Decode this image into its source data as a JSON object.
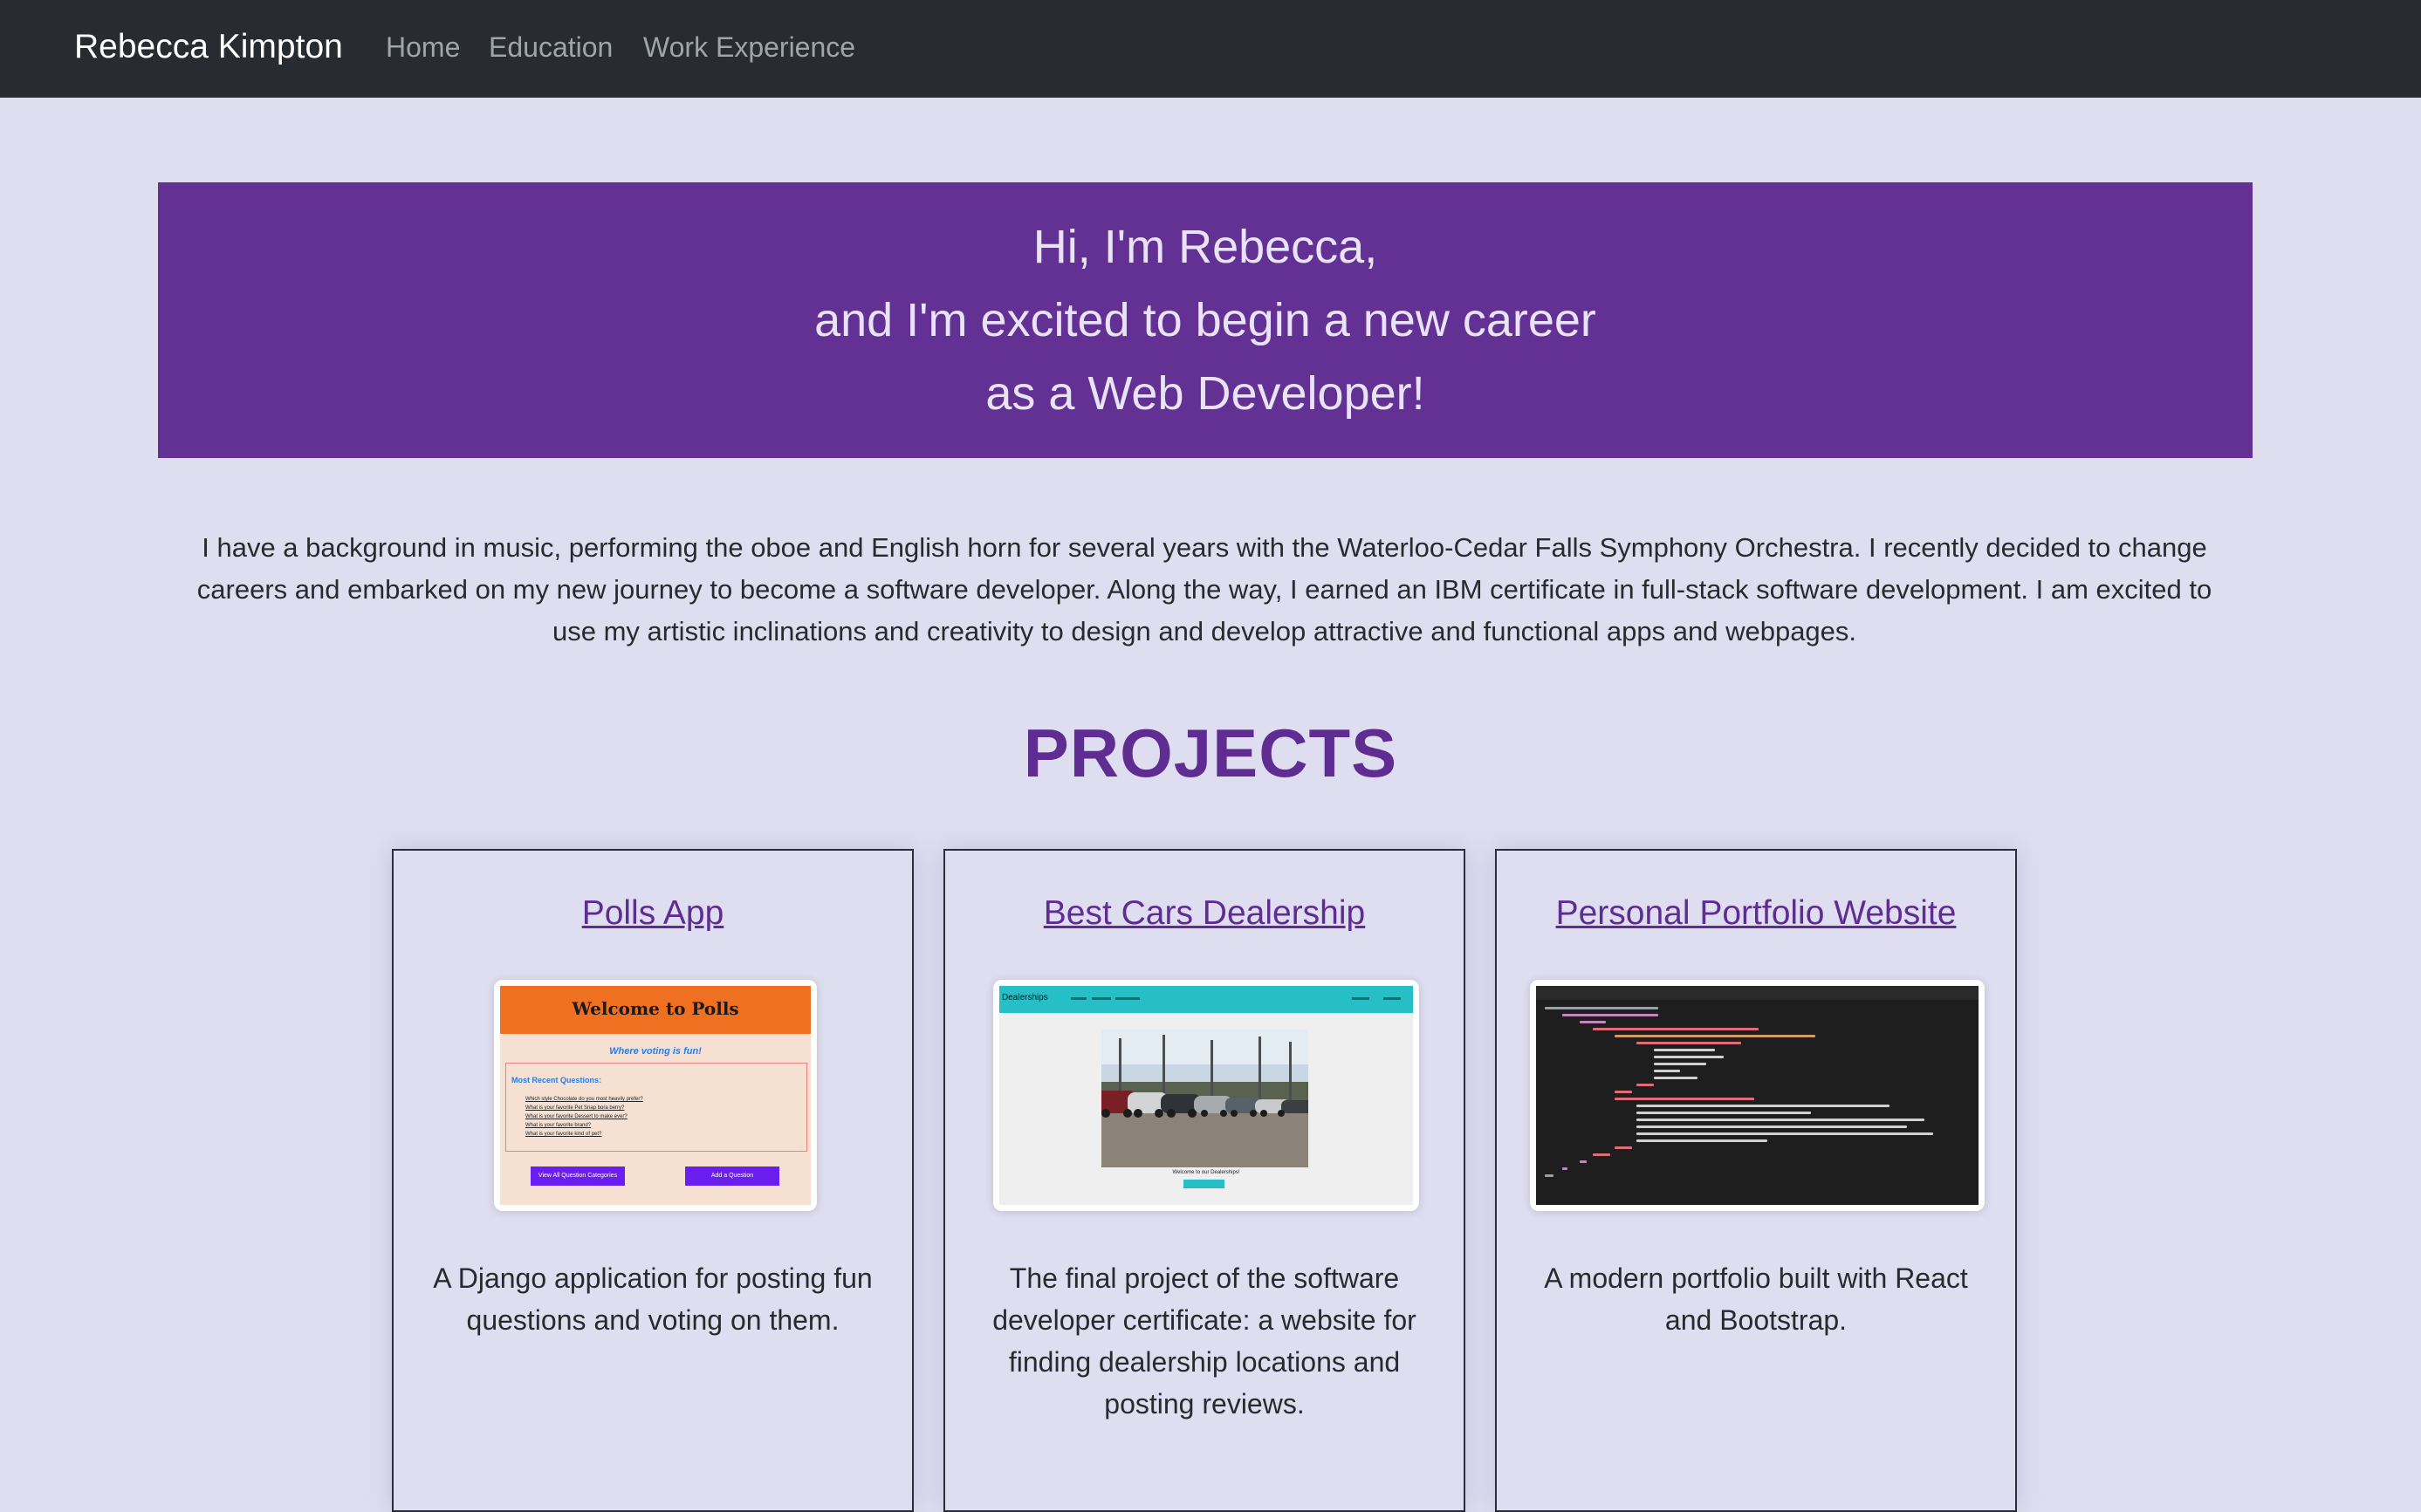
{
  "navbar": {
    "brand": "Rebecca Kimpton",
    "links": [
      "Home",
      "Education",
      "Work Experience"
    ]
  },
  "hero": {
    "lines": [
      "Hi, I'm Rebecca,",
      "and I'm excited to begin a new career",
      "as a Web Developer!"
    ]
  },
  "intro": {
    "text": "I have a background in music, performing the oboe and English horn for several years with the Waterloo-Cedar Falls Symphony Orchestra. I recently decided to change careers and embarked on my new journey to become a software developer. Along the way, I earned an IBM certificate in full-stack software development. I am excited to use my artistic inclinations and creativity to design and develop attractive and functional apps and webpages."
  },
  "projects": {
    "heading": "PROJECTS",
    "cards": [
      {
        "title": "Polls App",
        "description": "A Django application for posting fun questions and voting on them.",
        "thumbnail": {
          "header": "Welcome to Polls",
          "subtitle": "Where voting is fun!",
          "box_title": "Most Recent Questions:",
          "questions": [
            "Which style Chocolate do you most heavily prefer?",
            "What is your favorite Pet Snap bora berry?",
            "What is your favorite Dessert to make ever?",
            "What is your favorite brand?",
            "What is your favorite kind of pet?"
          ],
          "buttons": [
            "View All Question Categories",
            "Add a Question"
          ]
        }
      },
      {
        "title": "Best Cars Dealership",
        "description": "The final project of the software developer certificate: a website for finding dealership locations and posting reviews.",
        "thumbnail": {
          "nav_brand": "Dealerships",
          "caption": "Welcome to our Dealerships!"
        }
      },
      {
        "title": "Personal Portfolio Website",
        "description": "A modern portfolio built with React and Bootstrap."
      }
    ]
  },
  "colors": {
    "page_bg": "#dfdef0",
    "navbar_bg": "#282b30",
    "hero_bg": "#633194",
    "accent": "#5f2d92"
  }
}
